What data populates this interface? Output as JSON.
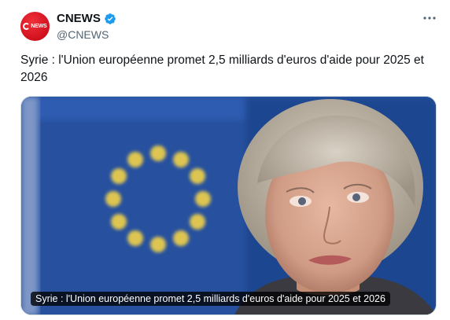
{
  "account": {
    "name": "CNEWS",
    "handle": "@CNEWS",
    "avatar_text": "NEWS",
    "verified_icon": "verified-badge-icon",
    "brand_color": "#d0101c",
    "verified_color": "#1d9bf0"
  },
  "menu": {
    "icon": "more-horizontal-icon"
  },
  "tweet": {
    "text": "Syrie : l'Union européenne promet 2,5 milliards d'euros d'aide pour 2025 et 2026"
  },
  "media": {
    "caption": "Syrie : l'Union européenne promet 2,5 milliards d'euros d'aide pour 2025 et 2026",
    "flag_color": "#2350a8",
    "star_color": "#f2d24a"
  }
}
